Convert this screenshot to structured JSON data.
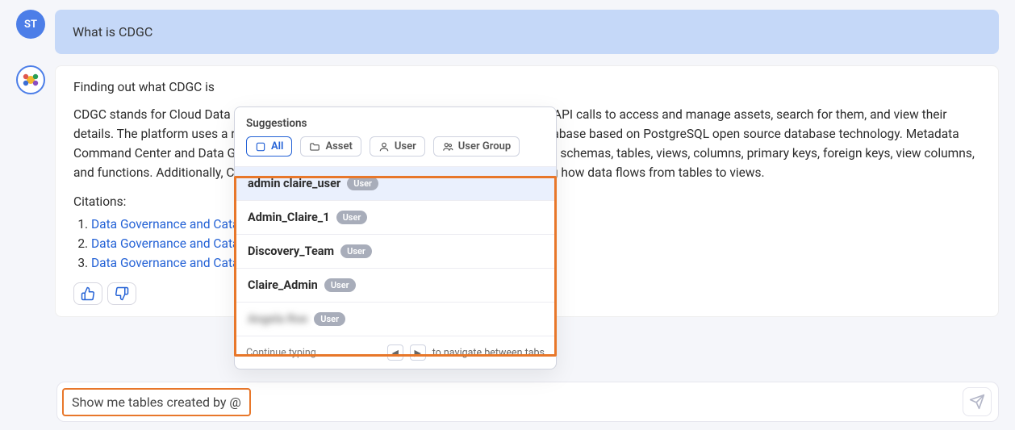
{
  "user": {
    "initials": "ST",
    "message": "What is CDGC"
  },
  "bot": {
    "heading": "Finding out what CDGC is",
    "body": "CDGC stands for Cloud Data Governance and Catalog. The system allows you to make API calls to access and manage assets, search for them, and view their details. The platform uses a relational, ACID-compliant transaction processing SQL database based on PostgreSQL open source database technology. Metadata Command Center and Data Governance can scan source systems, including databases, schemas, tables, views, columns, primary keys, foreign keys, view columns, and functions. Additionally, CDGC supports data lineage for Greenplum assets, showing how data flows from tables to views.",
    "citations_label": "Citations:",
    "citations": [
      "Data Governance and Catalog — Asset Details Reference",
      "Data Governance and Catalog — Asset Details Reference",
      "Data Governance and Catalog — Asset Details Reference"
    ]
  },
  "suggestions": {
    "title": "Suggestions",
    "filters": [
      "All",
      "Asset",
      "User",
      "User Group"
    ],
    "active_filter": "All",
    "items": [
      {
        "name": "admin claire_user",
        "tag": "User",
        "selected": true
      },
      {
        "name": "Admin_Claire_1",
        "tag": "User",
        "selected": false
      },
      {
        "name": "Discovery_Team",
        "tag": "User",
        "selected": false
      },
      {
        "name": "Claire_Admin",
        "tag": "User",
        "selected": false
      },
      {
        "name": "Angela Roe",
        "tag": "User",
        "selected": false,
        "blurred": true
      }
    ],
    "continue_hint": "Continue typing…",
    "nav_hint": "to navigate between tabs"
  },
  "input": {
    "value": "Show me tables created by @"
  }
}
